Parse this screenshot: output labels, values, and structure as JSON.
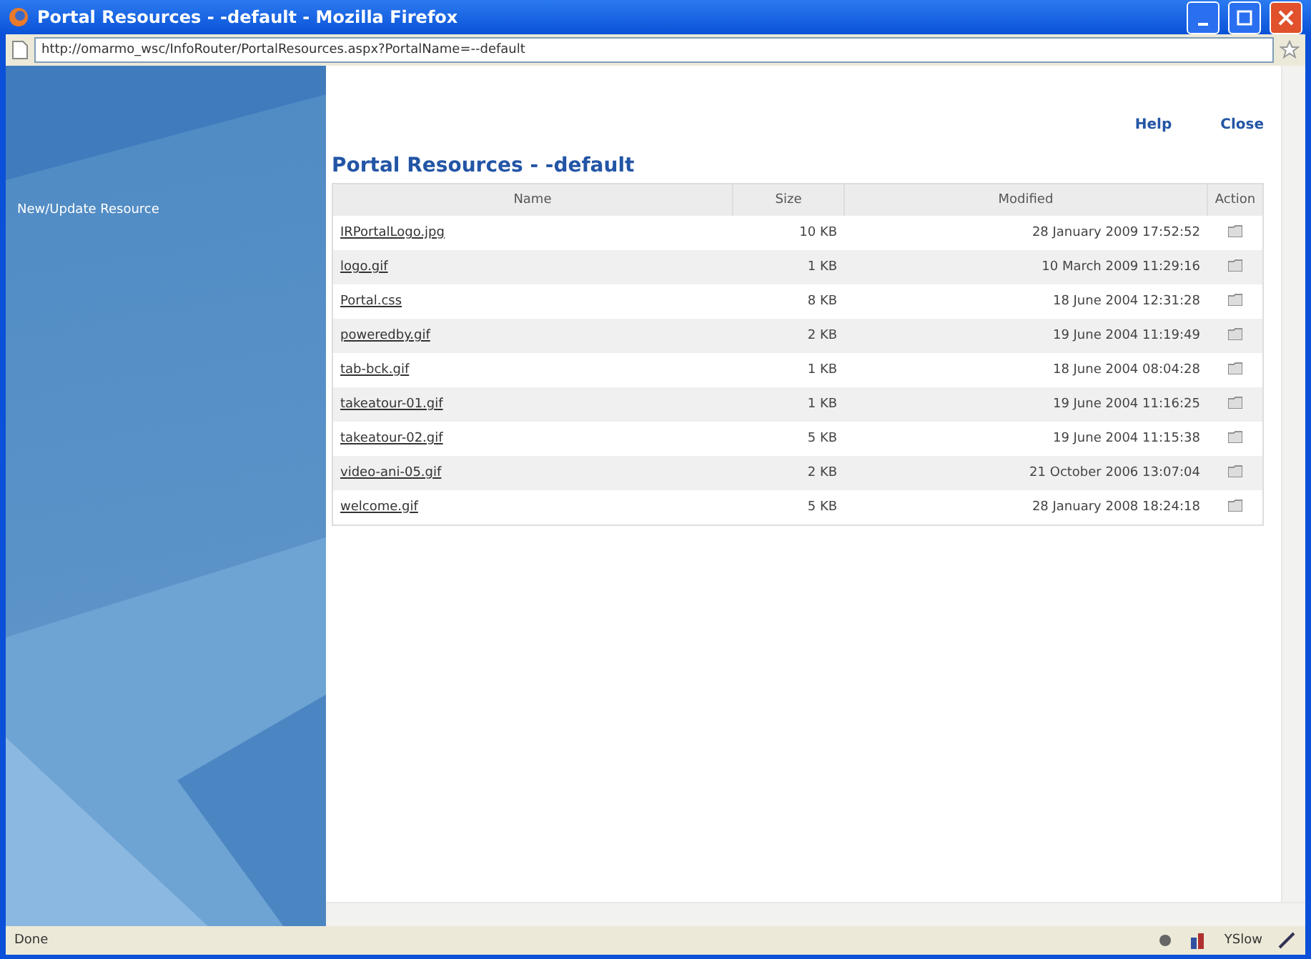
{
  "window": {
    "title": "Portal Resources - -default - Mozilla Firefox"
  },
  "address_bar": {
    "url": "http://omarmo_wsc/InfoRouter/PortalResources.aspx?PortalName=--default"
  },
  "sidebar": {
    "items": [
      {
        "label": "New/Update Resource"
      }
    ]
  },
  "header": {
    "title": "Portal Resources - -default",
    "links": [
      "Help",
      "Close"
    ]
  },
  "table": {
    "columns": [
      "Name",
      "Size",
      "Modified",
      "Action"
    ],
    "rows": [
      {
        "name": "IRPortalLogo.jpg",
        "size": "10 KB",
        "modified": "28 January 2009 17:52:52"
      },
      {
        "name": "logo.gif",
        "size": "1 KB",
        "modified": "10 March 2009 11:29:16"
      },
      {
        "name": "Portal.css",
        "size": "8 KB",
        "modified": "18 June 2004 12:31:28"
      },
      {
        "name": "poweredby.gif",
        "size": "2 KB",
        "modified": "19 June 2004 11:19:49"
      },
      {
        "name": "tab-bck.gif",
        "size": "1 KB",
        "modified": "18 June 2004 08:04:28"
      },
      {
        "name": "takeatour-01.gif",
        "size": "1 KB",
        "modified": "19 June 2004 11:16:25"
      },
      {
        "name": "takeatour-02.gif",
        "size": "5 KB",
        "modified": "19 June 2004 11:15:38"
      },
      {
        "name": "video-ani-05.gif",
        "size": "2 KB",
        "modified": "21 October 2006 13:07:04"
      },
      {
        "name": "welcome.gif",
        "size": "5 KB",
        "modified": "28 January 2008 18:24:18"
      }
    ]
  },
  "status_bar": {
    "text": "Done",
    "zoom": "YSlow"
  }
}
